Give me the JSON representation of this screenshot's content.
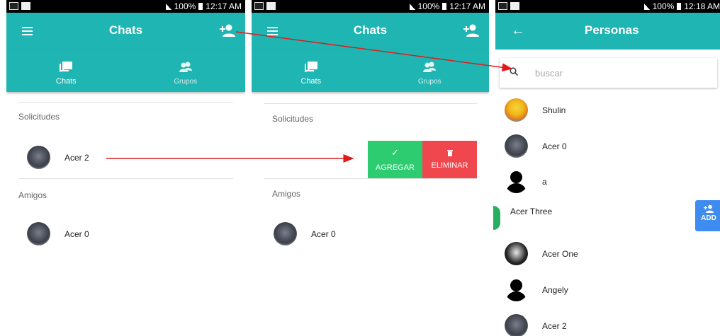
{
  "status_bar": {
    "screen1_time": "12:17 AM",
    "screen2_time": "12:17 AM",
    "screen3_time": "12:18 AM",
    "battery": "100%"
  },
  "screen1": {
    "title": "Chats",
    "tabs": [
      {
        "label": "Chats"
      },
      {
        "label": "Grupos"
      }
    ],
    "requests_label": "Solicitudes",
    "request_contact": "Acer 2",
    "friends_label": "Amigos",
    "friend_contact": "Acer 0"
  },
  "screen2": {
    "title": "Chats",
    "tabs": [
      {
        "label": "Chats"
      },
      {
        "label": "Grupos"
      }
    ],
    "requests_label": "Solicitudes",
    "accept_label": "AGREGAR",
    "delete_label": "ELIMINAR",
    "friends_label": "Amigos",
    "friend_contact": "Acer 0"
  },
  "screen3": {
    "title": "Personas",
    "search_placeholder": "buscar",
    "people": [
      {
        "name": "Shulin",
        "avatar": "cartoon"
      },
      {
        "name": "Acer 0",
        "avatar": "car"
      },
      {
        "name": "a",
        "avatar": "person"
      },
      {
        "name": "Acer Three",
        "avatar": "green-circle"
      },
      {
        "name": "Acer One",
        "avatar": "dark-photo"
      },
      {
        "name": "Angely",
        "avatar": "person"
      },
      {
        "name": "Acer 2",
        "avatar": "car"
      }
    ],
    "add_button_label": "ADD"
  },
  "colors": {
    "appbar": "#1fb5b2",
    "accept": "#2ecc71",
    "delete": "#f0474e",
    "arrow": "#e01b1b",
    "fab": "#3f8cf0"
  }
}
